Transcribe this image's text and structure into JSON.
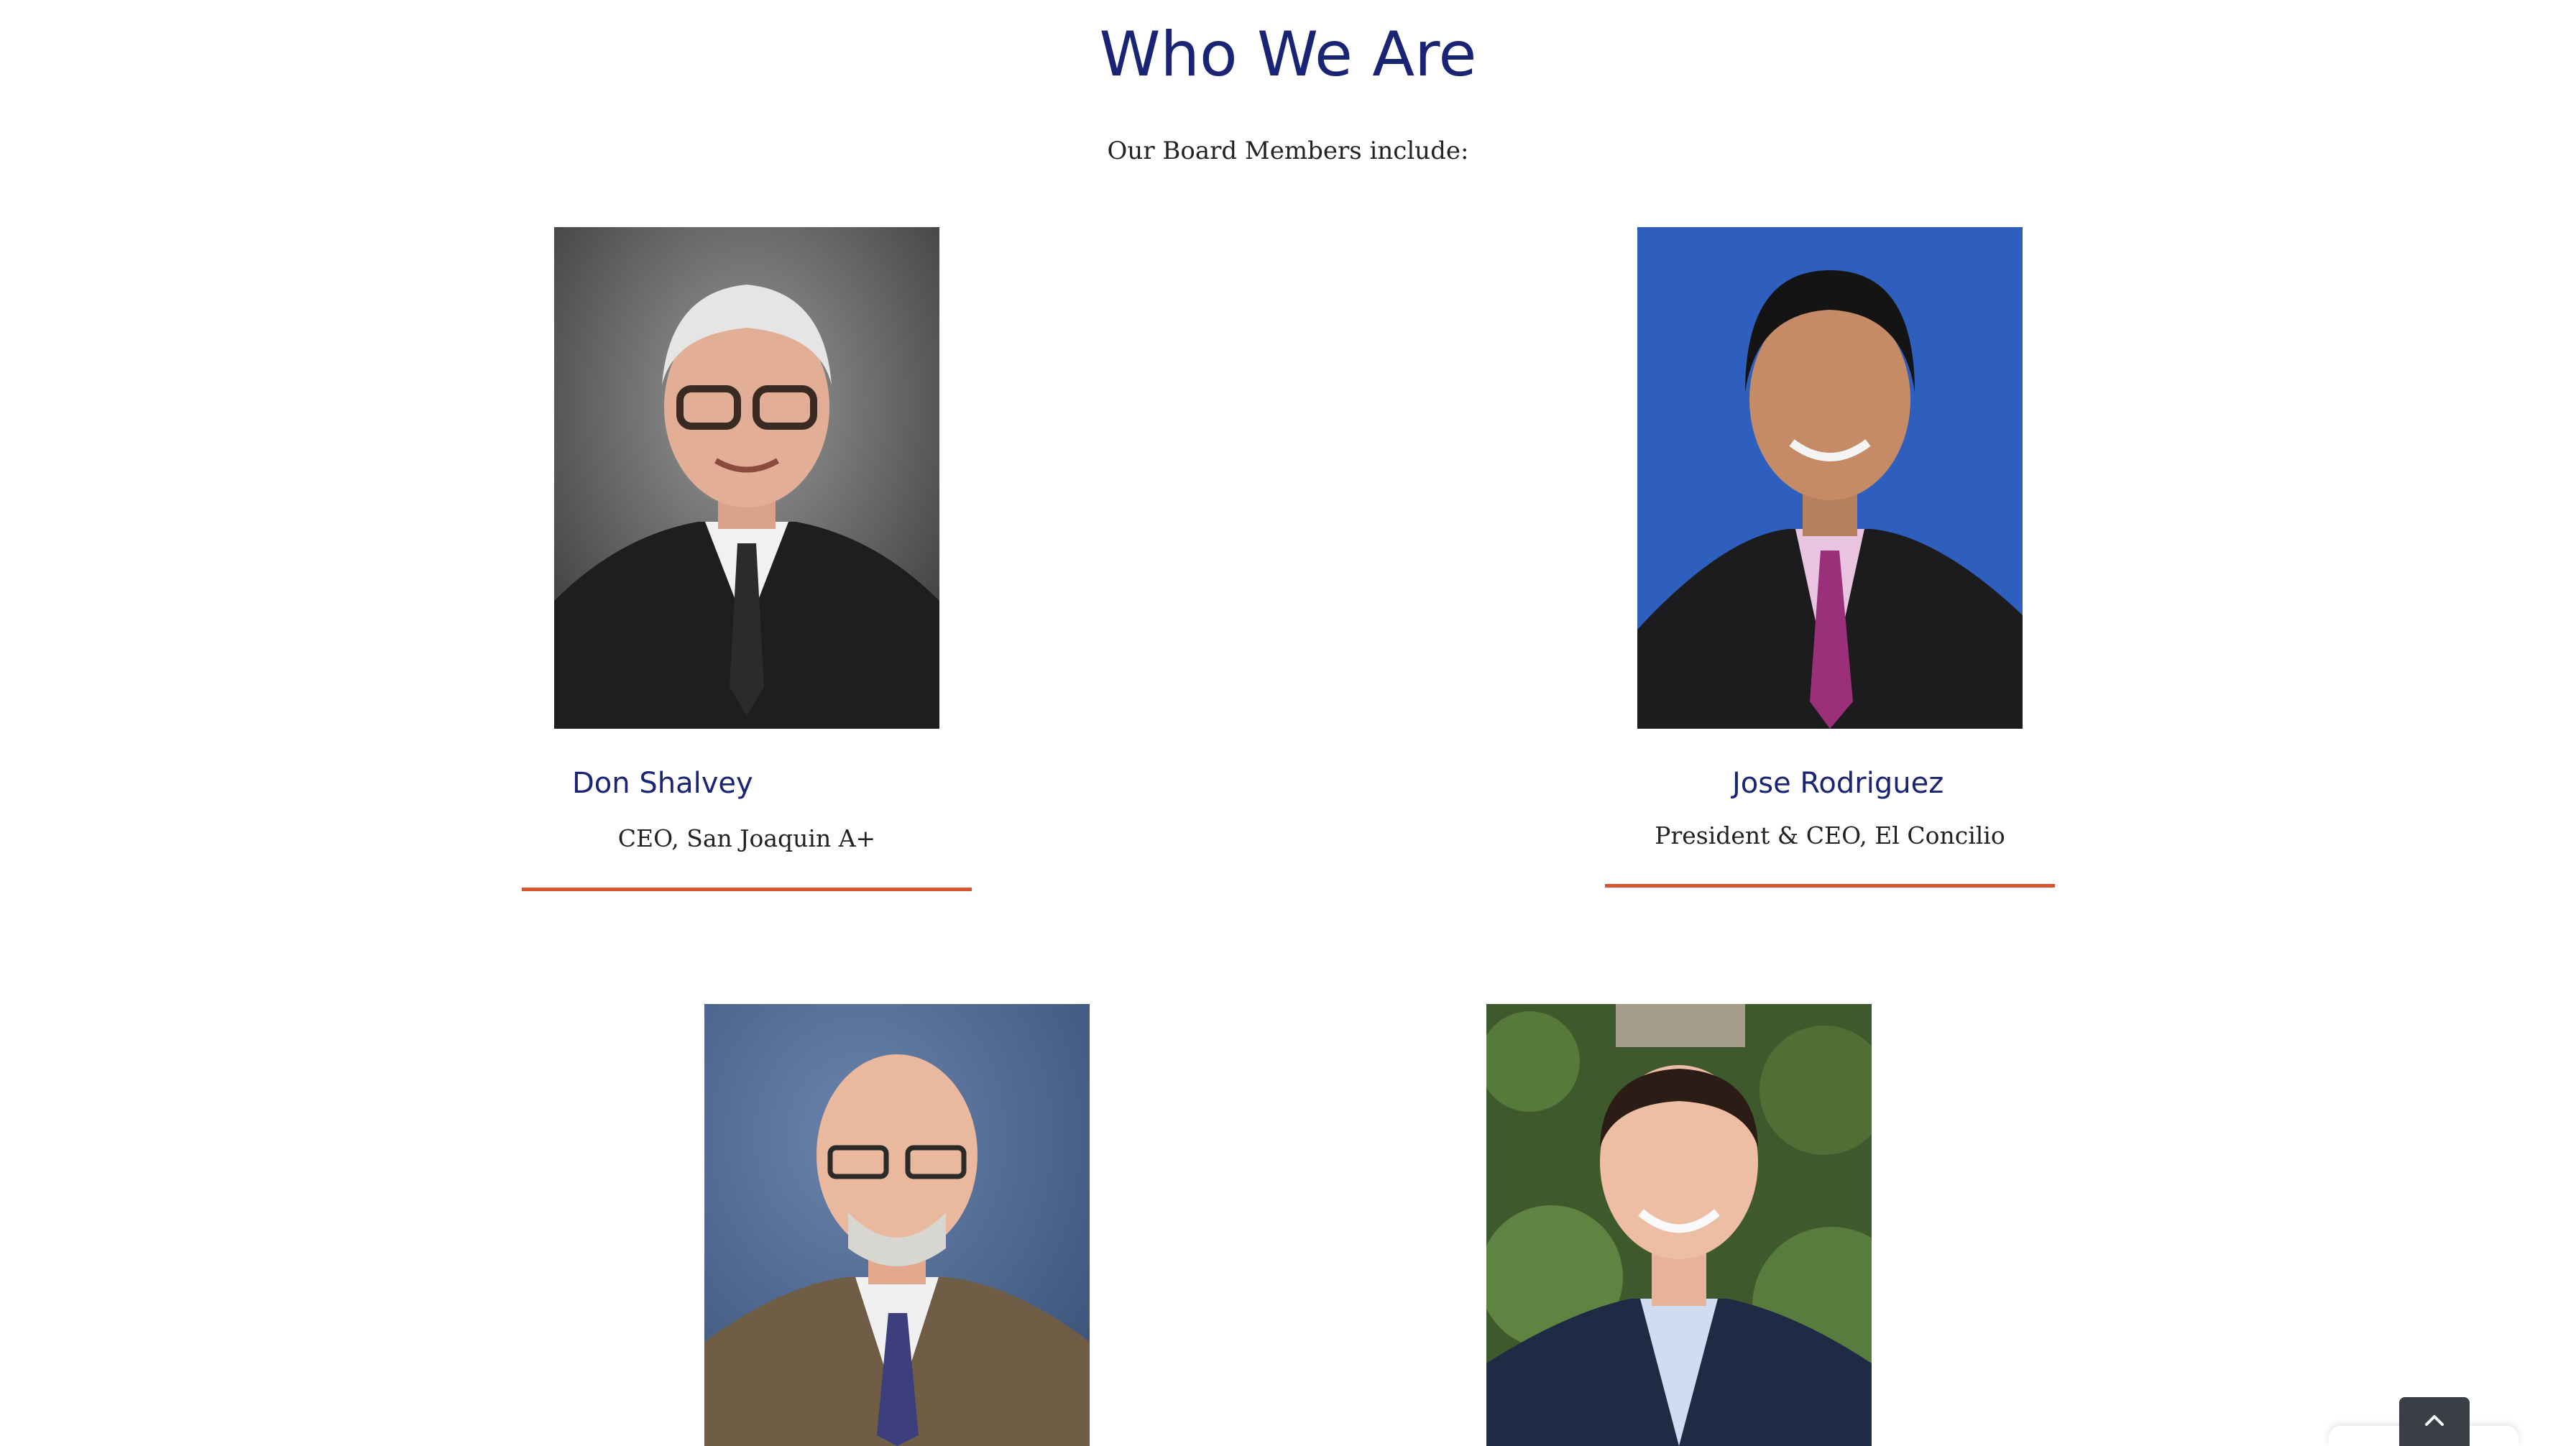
{
  "section": {
    "title": "Who We Are",
    "intro": "Our Board Members include:"
  },
  "members": [
    {
      "name": "Don Shalvey",
      "role": "CEO, San Joaquin A+"
    },
    {
      "name": "Jose Rodriguez",
      "role": "President & CEO, El Concilio"
    },
    {
      "name": "",
      "role": ""
    },
    {
      "name": "",
      "role": ""
    }
  ],
  "colors": {
    "heading": "#1a2474",
    "divider": "#d4552f",
    "scroll_button": "#3a3f45"
  },
  "icons": {
    "scroll_top": "chevron-up-icon"
  }
}
